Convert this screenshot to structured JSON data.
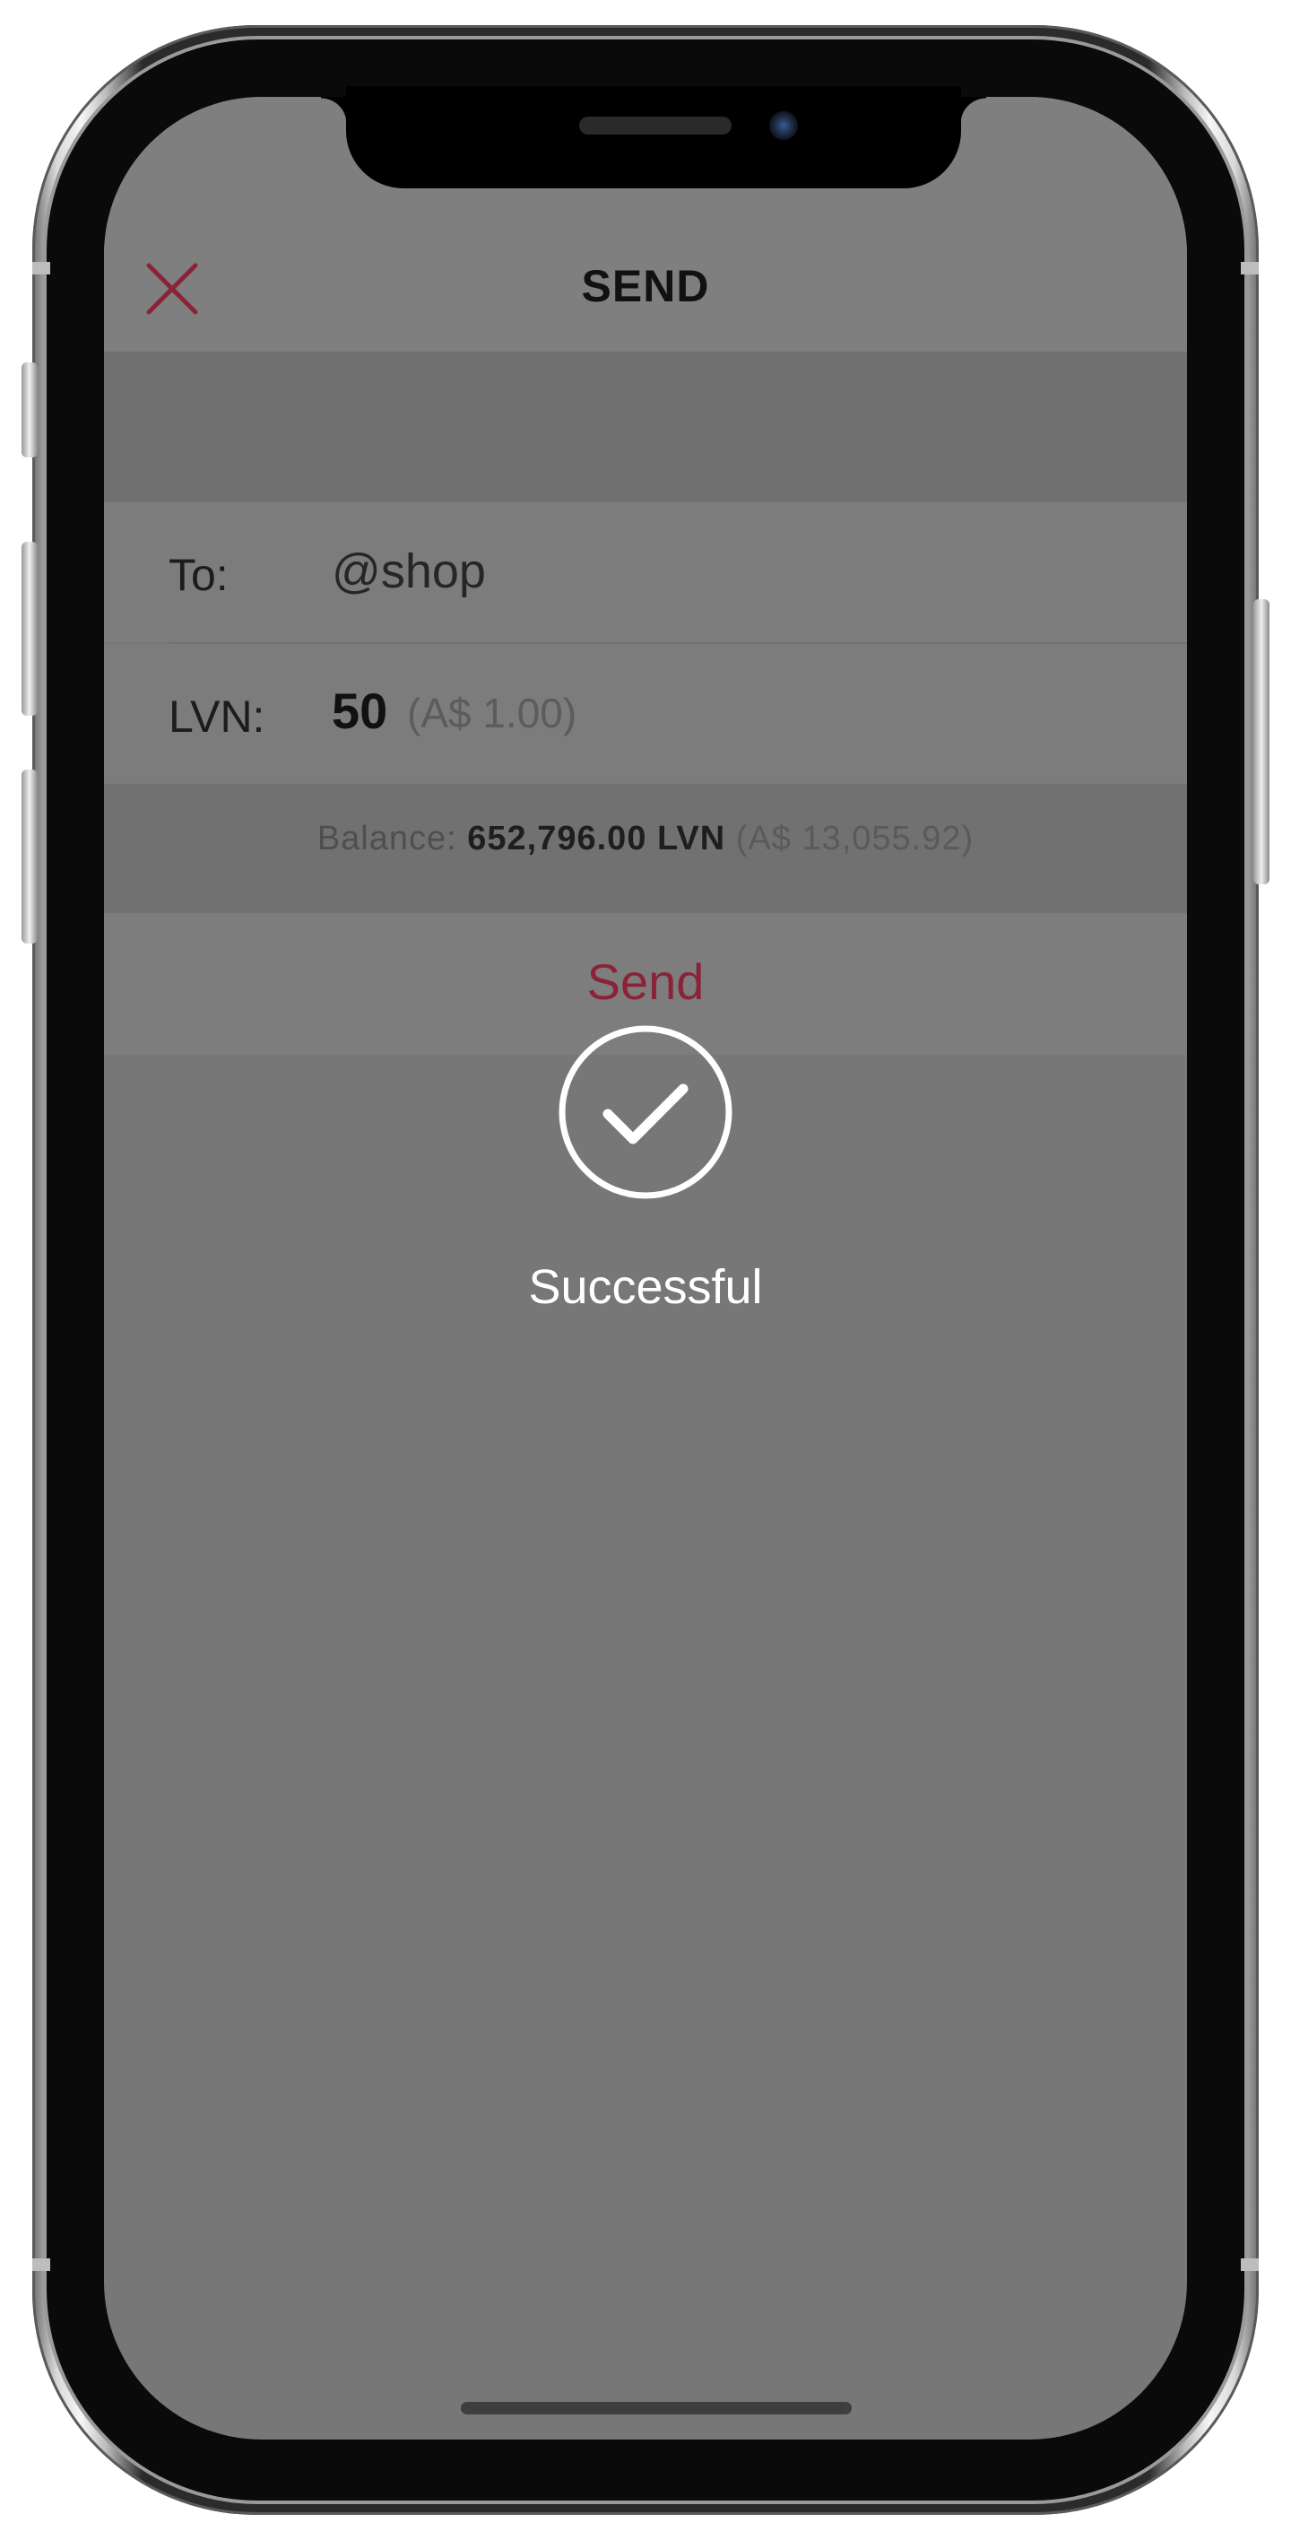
{
  "header": {
    "title": "SEND",
    "close_icon": "close-icon"
  },
  "form": {
    "to_label": "To:",
    "to_value": "@shop",
    "amount_label": "LVN:",
    "amount_value": "50",
    "amount_fiat": "(A$ 1.00)"
  },
  "balance": {
    "label": "Balance:",
    "amount": "652,796.00 LVN",
    "fiat": "(A$ 13,055.92)"
  },
  "send_button": {
    "label": "Send"
  },
  "overlay": {
    "icon": "checkmark-circle-icon",
    "message": "Successful"
  },
  "colors": {
    "accent": "#8b2338",
    "overlay_background": "#777777",
    "success_text": "#ffffff"
  }
}
